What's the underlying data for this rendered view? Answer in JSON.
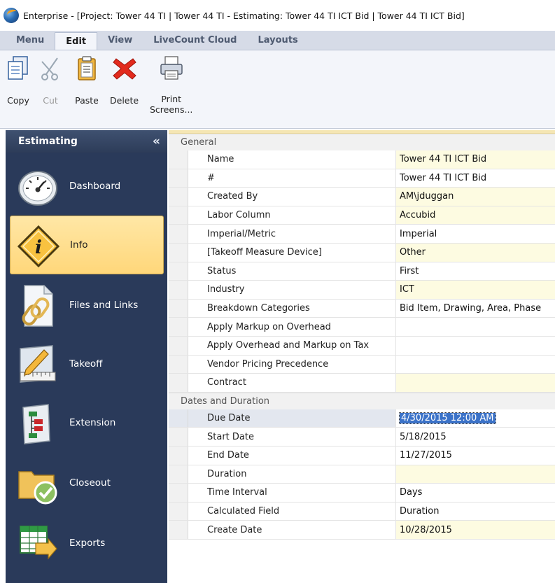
{
  "window": {
    "title": "Enterprise - [Project: Tower 44 TI | Tower 44 TI - Estimating: Tower 44 TI ICT Bid | Tower 44 TI ICT Bid]"
  },
  "menu": {
    "tabs": [
      {
        "label": "Menu"
      },
      {
        "label": "Edit"
      },
      {
        "label": "View"
      },
      {
        "label": "LiveCount Cloud"
      },
      {
        "label": "Layouts"
      }
    ],
    "active_tab": "Edit"
  },
  "ribbon": {
    "copy": "Copy",
    "cut": "Cut",
    "paste": "Paste",
    "delete": "Delete",
    "print_line1": "Print",
    "print_line2": "Screens..."
  },
  "sidebar": {
    "title": "Estimating",
    "collapse_glyph": "«",
    "items": [
      {
        "label": "Dashboard",
        "icon": "gauge-icon"
      },
      {
        "label": "Info",
        "icon": "info-sign-icon"
      },
      {
        "label": "Files and Links",
        "icon": "file-link-icon"
      },
      {
        "label": "Takeoff",
        "icon": "ruler-pencil-icon"
      },
      {
        "label": "Extension",
        "icon": "tree-document-icon"
      },
      {
        "label": "Closeout",
        "icon": "folder-check-icon"
      },
      {
        "label": "Exports",
        "icon": "spreadsheet-export-icon"
      }
    ],
    "active_item": "Info"
  },
  "grid": {
    "general": {
      "title": "General",
      "rows": [
        {
          "name": "Name",
          "value": "Tower 44 TI ICT Bid"
        },
        {
          "name": "#",
          "value": "Tower 44 TI ICT Bid"
        },
        {
          "name": "Created By",
          "value": "AM\\jduggan"
        },
        {
          "name": "Labor Column",
          "value": "Accubid"
        },
        {
          "name": "Imperial/Metric",
          "value": "Imperial"
        },
        {
          "name": "[Takeoff Measure Device]",
          "value": "Other"
        },
        {
          "name": "Status",
          "value": "First"
        },
        {
          "name": "Industry",
          "value": "ICT"
        },
        {
          "name": "Breakdown Categories",
          "value": "Bid Item, Drawing, Area, Phase"
        },
        {
          "name": "Apply Markup on Overhead",
          "value": ""
        },
        {
          "name": "Apply Overhead and Markup on Tax",
          "value": ""
        },
        {
          "name": "Vendor Pricing Precedence",
          "value": ""
        },
        {
          "name": "Contract",
          "value": ""
        }
      ]
    },
    "dates": {
      "title": "Dates and Duration",
      "rows": [
        {
          "name": "Due Date",
          "value": "4/30/2015 12:00 AM"
        },
        {
          "name": "Start Date",
          "value": "5/18/2015"
        },
        {
          "name": "End Date",
          "value": "11/27/2015"
        },
        {
          "name": "Duration",
          "value": ""
        },
        {
          "name": "Time Interval",
          "value": "Days"
        },
        {
          "name": "Calculated Field",
          "value": "Duration"
        },
        {
          "name": "Create Date",
          "value": "10/28/2015"
        }
      ]
    }
  },
  "colors": {
    "sidebar_bg": "#2a3a5a",
    "active_nav": "#ffd77a",
    "selection": "#3b72c8",
    "editable_cell": "#fdfbe1"
  }
}
